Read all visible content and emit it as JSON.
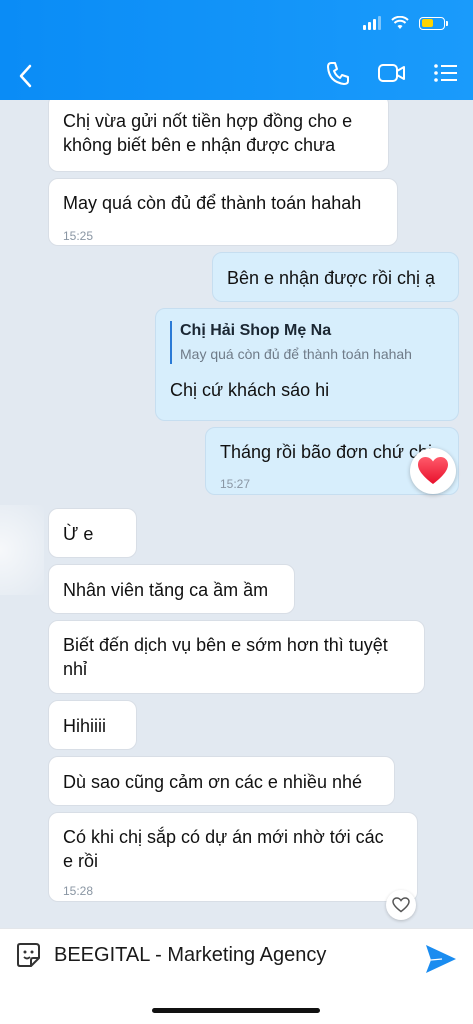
{
  "header": {
    "back_icon": "chevron-left-icon",
    "icons": [
      "phone-icon",
      "video-camera-icon",
      "menu-list-icon"
    ],
    "accent": "#0a8cf6",
    "battery_level": 0.55
  },
  "messages": [
    {
      "dir": "in",
      "lines": [
        "Chị vừa gửi nốt tiền hợp đồng cho e",
        "không biết bên e nhận được chưa"
      ]
    },
    {
      "dir": "in",
      "lines": [
        "May quá còn đủ để thành toán hahah"
      ],
      "time": "15:25"
    },
    {
      "dir": "out",
      "lines": [
        "Bên e nhận được rồi chị ạ"
      ]
    },
    {
      "dir": "out",
      "quote_name": "Chị Hải Shop Mẹ Na",
      "quote_text": "May quá còn đủ để thành toán hahah",
      "lines": [
        "Chị cứ khách sáo hi"
      ]
    },
    {
      "dir": "out",
      "lines": [
        "Tháng rồi bão đơn chứ chị"
      ],
      "time": "15:27",
      "reaction": "heart-icon"
    },
    {
      "dir": "in",
      "lines": [
        "Ừ e"
      ]
    },
    {
      "dir": "in",
      "lines": [
        "Nhân viên tăng ca ầm ầm"
      ]
    },
    {
      "dir": "in",
      "lines": [
        "Biết đến dịch vụ bên e sớm hơn thì tuyệt",
        "nhỉ"
      ]
    },
    {
      "dir": "in",
      "lines": [
        "Hihiiii"
      ]
    },
    {
      "dir": "in",
      "lines": [
        "Dù sao cũng cảm ơn các e nhiều nhé"
      ]
    },
    {
      "dir": "in",
      "lines": [
        "Có khi chị sắp có dự án mới nhờ tới các",
        "e rồi"
      ],
      "time": "15:28",
      "reaction": "heart-outline-icon"
    }
  ],
  "composer": {
    "value": "BEEGITAL - Marketing Agency",
    "sticker_icon": "sticker-icon",
    "send_icon": "send-icon"
  }
}
